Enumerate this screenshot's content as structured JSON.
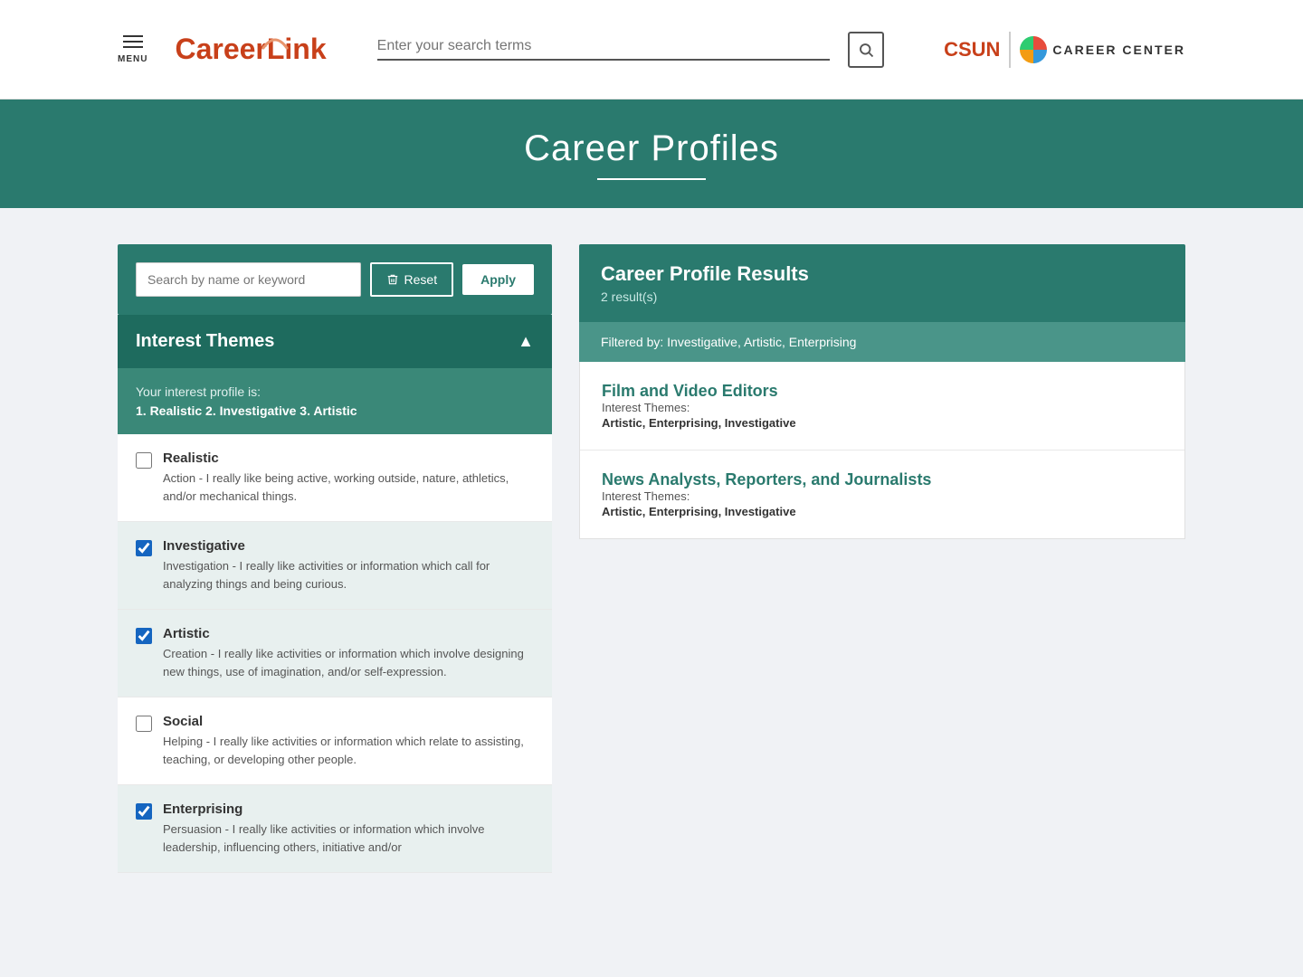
{
  "header": {
    "menu_label": "MENU",
    "logo_career": "Career",
    "logo_link": "Link",
    "search_placeholder": "Enter your search terms",
    "csun_label": "CSUN",
    "career_center_label": "CAREER CENTER"
  },
  "hero": {
    "title": "Career Profiles",
    "underline": true
  },
  "filter": {
    "search_placeholder": "Search by name or keyword",
    "reset_label": "Reset",
    "apply_label": "Apply"
  },
  "interest_themes": {
    "title": "Interest Themes",
    "profile_label": "Your interest profile is:",
    "profile_values": "1. Realistic   2. Investigative   3. Artistic",
    "items": [
      {
        "id": "realistic",
        "label": "Realistic",
        "description": "Action - I really like being active, working outside, nature, athletics, and/or mechanical things.",
        "checked": false
      },
      {
        "id": "investigative",
        "label": "Investigative",
        "description": "Investigation - I really like activities or information which call for analyzing things and being curious.",
        "checked": true
      },
      {
        "id": "artistic",
        "label": "Artistic",
        "description": "Creation - I really like activities or information which involve designing new things, use of imagination, and/or self-expression.",
        "checked": true
      },
      {
        "id": "social",
        "label": "Social",
        "description": "Helping - I really like activities or information which relate to assisting, teaching, or developing other people.",
        "checked": false
      },
      {
        "id": "enterprising",
        "label": "Enterprising",
        "description": "Persuasion - I really like activities or information which involve leadership, influencing others, initiative and/or",
        "checked": true
      }
    ]
  },
  "results": {
    "title": "Career Profile Results",
    "count": "2 result(s)",
    "filter_label": "Filtered by: Investigative, Artistic, Enterprising",
    "items": [
      {
        "title": "Film and Video Editors",
        "themes_label": "Interest Themes:",
        "themes": "Artistic, Enterprising, Investigative"
      },
      {
        "title": "News Analysts, Reporters, and Journalists",
        "themes_label": "Interest Themes:",
        "themes": "Artistic, Enterprising, Investigative"
      }
    ]
  }
}
